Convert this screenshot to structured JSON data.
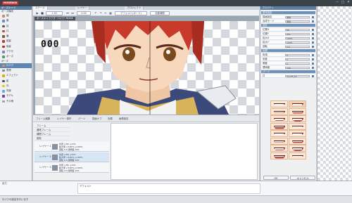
{
  "app": {
    "title": "MODEBOX",
    "window_buttons": [
      "—",
      "□",
      "✕"
    ]
  },
  "left_panel": {
    "header": "ボーズキャラ",
    "sections": [
      "ボーズ構成",
      "ボーズ"
    ],
    "items": [
      {
        "label": "顔",
        "color": "#d08a6a"
      },
      {
        "label": "服",
        "color": "#6a8ac0"
      },
      {
        "label": "目",
        "color": "#5a5a5a"
      },
      {
        "label": "口",
        "color": "#c24a4a"
      },
      {
        "label": "眉",
        "color": "#7a5a3a"
      },
      {
        "label": "前髪",
        "color": "#c0392b"
      },
      {
        "label": "後髪",
        "color": "#a93226"
      },
      {
        "label": "アクセ",
        "color": "#8e7cc3"
      },
      {
        "label": "ポーズ",
        "color": "#4f9d69"
      },
      {
        "label": "口パク",
        "color": "#e08a5a"
      },
      {
        "label": "表情",
        "color": "#7f8c8d"
      },
      {
        "label": "エフェクト",
        "color": "#d4ac0d"
      },
      {
        "label": "影",
        "color": "#555555"
      },
      {
        "label": "光",
        "color": "#f1c40f"
      },
      {
        "label": "背景",
        "color": "#5dade2"
      },
      {
        "label": "モデル",
        "color": "#7d3c98"
      },
      {
        "label": "その他",
        "color": "#95a5a6"
      }
    ],
    "active_index": 9
  },
  "center": {
    "doc_tabs": [
      "ステージ",
      "レイヤー",
      "プロジェクト"
    ],
    "toolbar": {
      "zoom": "1:30",
      "frame": "0:00",
      "preset": "デフォルト(ボード)",
      "mode": "自動補間"
    },
    "view_tab": "ボーズキャラクター口パク MODE",
    "frame_digits": "000"
  },
  "bottom": {
    "tabs": [
      "フレーム編集",
      "レイヤー操作",
      "パーツ",
      "描画オプ",
      "効果",
      "画像設定"
    ],
    "list_items": [
      "フレーム",
      "通常フレーム",
      "補間フレーム",
      "削除"
    ],
    "layers": [
      {
        "name": "レイヤー 1",
        "info": [
          "位置 x:56, y:211",
          "拡大率 x:100% y:100%",
          "回転 0.0 透明度 100"
        ]
      },
      {
        "name": "レイヤー 2",
        "info": [
          "位置 x:56, y:211",
          "拡大率 x:100% y:100%",
          "回転 0.0 透明度 100"
        ]
      },
      {
        "name": "レイヤー 3",
        "info": [
          "位置 x:56, y:211",
          "拡大率 x:100% y:100%",
          "回転 0.0 透明度 100"
        ]
      }
    ]
  },
  "right_panel": {
    "header": "プロパティ",
    "rows": [
      {
        "label": "基本設定",
        "header": true
      },
      {
        "label": "描画設定",
        "value": "通常"
      },
      {
        "label": "合成モード",
        "value": "通常"
      },
      {
        "label": "変形",
        "header": true
      },
      {
        "label": "位置X",
        "value": "56"
      },
      {
        "label": "位置Y",
        "value": "211"
      },
      {
        "label": "拡大X",
        "value": "100%"
      },
      {
        "label": "拡大Y",
        "value": "100%"
      },
      {
        "label": "回転",
        "value": "0.0"
      },
      {
        "label": "色調",
        "header": true
      },
      {
        "label": "色相",
        "value": "0"
      },
      {
        "label": "彩度",
        "value": "0"
      },
      {
        "label": "明度",
        "value": "0"
      },
      {
        "label": "透明度",
        "value": "100"
      },
      {
        "label": "パーツ",
        "header": true
      },
      {
        "label": "口",
        "value": "mouth_01"
      }
    ],
    "ok": "OK",
    "cancel": "キャンセル"
  },
  "output": {
    "label": "出力",
    "value": "デフォルト"
  },
  "status": {
    "text": "口パクの設定を行います"
  }
}
